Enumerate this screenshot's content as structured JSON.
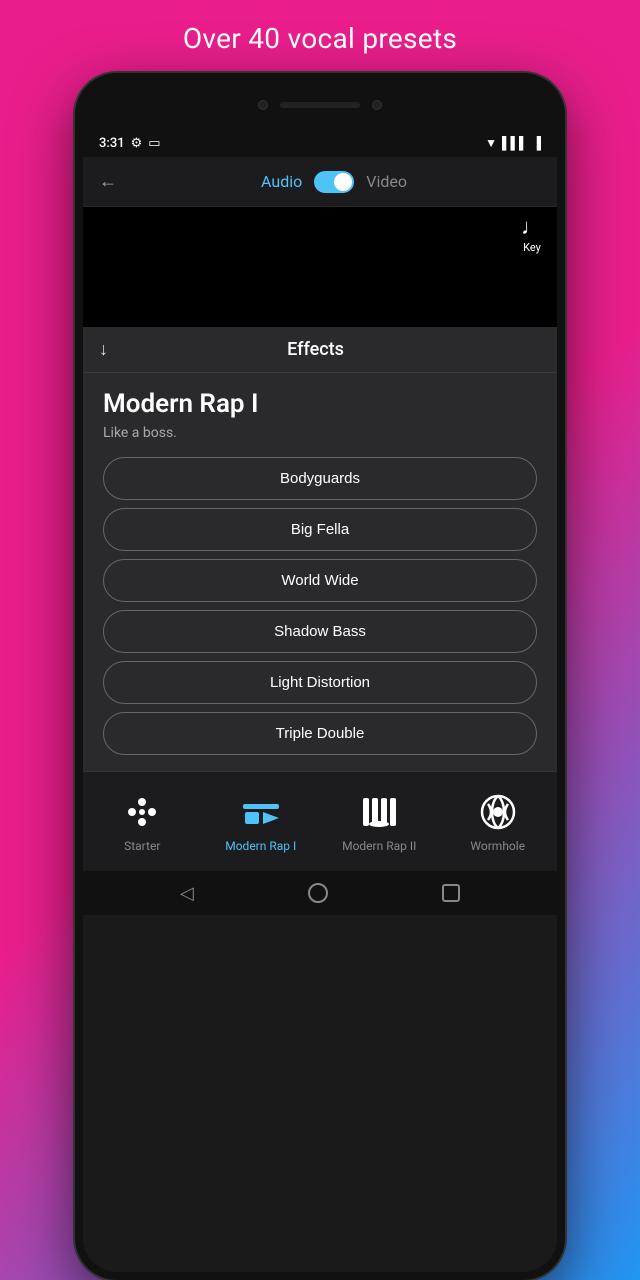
{
  "page": {
    "background_title": "Over 40 vocal presets"
  },
  "status_bar": {
    "time": "3:31",
    "gear": "⚙",
    "battery_icon": "🔋"
  },
  "header": {
    "back_label": "←",
    "audio_label": "Audio",
    "video_label": "Video"
  },
  "key_button": {
    "icon": "𝄞",
    "label": "Key"
  },
  "effects": {
    "title": "Effects",
    "download_icon": "↓"
  },
  "preset": {
    "name": "Modern Rap I",
    "description": "Like a boss.",
    "buttons": [
      "Bodyguards",
      "Big Fella",
      "World Wide",
      "Shadow Bass",
      "Light Distortion",
      "Triple Double"
    ]
  },
  "bottom_nav": {
    "items": [
      {
        "label": "Starter",
        "active": false
      },
      {
        "label": "Modern Rap I",
        "active": true
      },
      {
        "label": "Modern Rap II",
        "active": false
      },
      {
        "label": "Wormhole",
        "active": false
      }
    ]
  }
}
